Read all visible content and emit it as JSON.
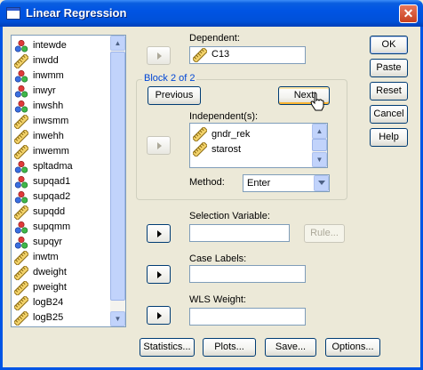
{
  "window": {
    "title": "Linear Regression",
    "close_glyph": "✕"
  },
  "variables": [
    {
      "name": "intewde",
      "type": "nominal"
    },
    {
      "name": "inwdd",
      "type": "scale"
    },
    {
      "name": "inwmm",
      "type": "nominal"
    },
    {
      "name": "inwyr",
      "type": "nominal"
    },
    {
      "name": "inwshh",
      "type": "nominal"
    },
    {
      "name": "inwsmm",
      "type": "scale"
    },
    {
      "name": "inwehh",
      "type": "scale"
    },
    {
      "name": "inwemm",
      "type": "scale"
    },
    {
      "name": "spltadma",
      "type": "nominal"
    },
    {
      "name": "supqad1",
      "type": "nominal"
    },
    {
      "name": "supqad2",
      "type": "nominal"
    },
    {
      "name": "supqdd",
      "type": "scale"
    },
    {
      "name": "supqmm",
      "type": "nominal"
    },
    {
      "name": "supqyr",
      "type": "nominal"
    },
    {
      "name": "inwtm",
      "type": "scale"
    },
    {
      "name": "dweight",
      "type": "scale"
    },
    {
      "name": "pweight",
      "type": "scale"
    },
    {
      "name": "logB24",
      "type": "scale"
    },
    {
      "name": "logB25",
      "type": "scale"
    }
  ],
  "dependent": {
    "label": "Dependent:",
    "value": "C13",
    "value_type": "scale"
  },
  "block": {
    "title": "Block 2 of 2",
    "previous": "Previous",
    "next": "Next"
  },
  "independents": {
    "label": "Independent(s):",
    "items": [
      {
        "name": "gndr_rek",
        "type": "scale"
      },
      {
        "name": "starost",
        "type": "scale"
      }
    ]
  },
  "method": {
    "label": "Method:",
    "value": "Enter"
  },
  "selection": {
    "label": "Selection Variable:",
    "value": "",
    "rule_button": "Rule..."
  },
  "case_labels": {
    "label": "Case Labels:",
    "value": ""
  },
  "wls": {
    "label": "WLS Weight:",
    "value": ""
  },
  "side_buttons": {
    "ok": "OK",
    "paste": "Paste",
    "reset": "Reset",
    "cancel": "Cancel",
    "help": "Help"
  },
  "bottom_buttons": {
    "statistics": "Statistics...",
    "plots": "Plots...",
    "save": "Save...",
    "options": "Options..."
  },
  "icons": {
    "scale": "ruler-icon",
    "nominal": "nominal-variable-icon",
    "arrow": "right-arrow-icon",
    "cursor": "mouse-pointer-icon"
  },
  "colors": {
    "titlebar": "#0054e3",
    "dialog_bg": "#ece9d8",
    "group_title": "#0046d5",
    "button_border": "#003c74",
    "hover_highlight": "#f8b331"
  }
}
